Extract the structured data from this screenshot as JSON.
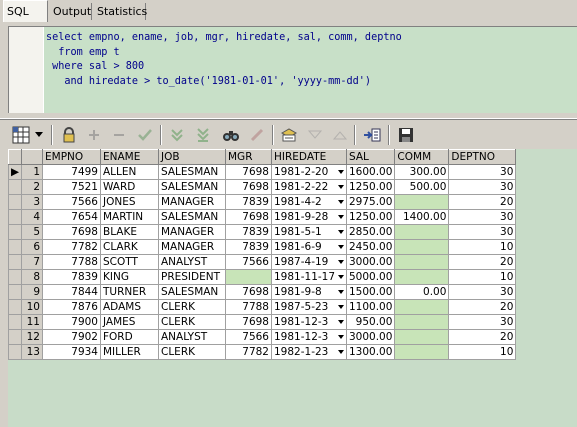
{
  "tabs": [
    "SQL",
    "Output",
    "Statistics"
  ],
  "sql": {
    "lines": [
      "select empno, ename, job, mgr, hiredate, sal, comm, deptno",
      "  from emp t",
      " where sal > 800",
      "   and hiredate > to_date('1981-01-01', 'yyyy-mm-dd')"
    ]
  },
  "toolbar": {
    "icons": [
      "grid-layout-icon",
      "dropdown-arrow-icon",
      "lock-icon",
      "add-record-icon",
      "delete-record-icon",
      "post-changes-icon",
      "fetch-next-icon",
      "fetch-last-icon",
      "find-icon",
      "clear-icon",
      "query-by-example-icon",
      "filter-down-icon",
      "filter-up-icon",
      "export-icon",
      "save-icon"
    ]
  },
  "grid": {
    "columns": [
      "EMPNO",
      "ENAME",
      "JOB",
      "MGR",
      "HIREDATE",
      "SAL",
      "COMM",
      "DEPTNO"
    ],
    "rows": [
      {
        "n": "1",
        "empno": "7499",
        "ename": "ALLEN",
        "job": "SALESMAN",
        "mgr": "7698",
        "hiredate": "1981-2-20",
        "sal": "1600.00",
        "comm": "300.00",
        "deptno": "30"
      },
      {
        "n": "2",
        "empno": "7521",
        "ename": "WARD",
        "job": "SALESMAN",
        "mgr": "7698",
        "hiredate": "1981-2-22",
        "sal": "1250.00",
        "comm": "500.00",
        "deptno": "30"
      },
      {
        "n": "3",
        "empno": "7566",
        "ename": "JONES",
        "job": "MANAGER",
        "mgr": "7839",
        "hiredate": "1981-4-2",
        "sal": "2975.00",
        "comm": "",
        "deptno": "20"
      },
      {
        "n": "4",
        "empno": "7654",
        "ename": "MARTIN",
        "job": "SALESMAN",
        "mgr": "7698",
        "hiredate": "1981-9-28",
        "sal": "1250.00",
        "comm": "1400.00",
        "deptno": "30"
      },
      {
        "n": "5",
        "empno": "7698",
        "ename": "BLAKE",
        "job": "MANAGER",
        "mgr": "7839",
        "hiredate": "1981-5-1",
        "sal": "2850.00",
        "comm": "",
        "deptno": "30"
      },
      {
        "n": "6",
        "empno": "7782",
        "ename": "CLARK",
        "job": "MANAGER",
        "mgr": "7839",
        "hiredate": "1981-6-9",
        "sal": "2450.00",
        "comm": "",
        "deptno": "10"
      },
      {
        "n": "7",
        "empno": "7788",
        "ename": "SCOTT",
        "job": "ANALYST",
        "mgr": "7566",
        "hiredate": "1987-4-19",
        "sal": "3000.00",
        "comm": "",
        "deptno": "20"
      },
      {
        "n": "8",
        "empno": "7839",
        "ename": "KING",
        "job": "PRESIDENT",
        "mgr": "",
        "hiredate": "1981-11-17",
        "sal": "5000.00",
        "comm": "",
        "deptno": "10"
      },
      {
        "n": "9",
        "empno": "7844",
        "ename": "TURNER",
        "job": "SALESMAN",
        "mgr": "7698",
        "hiredate": "1981-9-8",
        "sal": "1500.00",
        "comm": "0.00",
        "deptno": "30"
      },
      {
        "n": "10",
        "empno": "7876",
        "ename": "ADAMS",
        "job": "CLERK",
        "mgr": "7788",
        "hiredate": "1987-5-23",
        "sal": "1100.00",
        "comm": "",
        "deptno": "20"
      },
      {
        "n": "11",
        "empno": "7900",
        "ename": "JAMES",
        "job": "CLERK",
        "mgr": "7698",
        "hiredate": "1981-12-3",
        "sal": "950.00",
        "comm": "",
        "deptno": "30"
      },
      {
        "n": "12",
        "empno": "7902",
        "ename": "FORD",
        "job": "ANALYST",
        "mgr": "7566",
        "hiredate": "1981-12-3",
        "sal": "3000.00",
        "comm": "",
        "deptno": "20"
      },
      {
        "n": "13",
        "empno": "7934",
        "ename": "MILLER",
        "job": "CLERK",
        "mgr": "7782",
        "hiredate": "1982-1-23",
        "sal": "1300.00",
        "comm": "",
        "deptno": "10"
      }
    ],
    "current_row_indicator": "▶"
  },
  "colors": {
    "sql_background": "#c8e0c8",
    "sql_text": "#00008b",
    "null_cell": "#c8e4b8",
    "grid_background": "#c8dcc8"
  }
}
